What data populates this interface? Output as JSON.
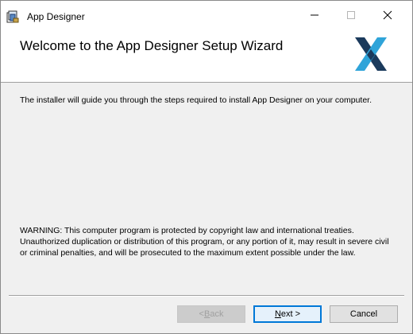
{
  "window": {
    "title": "App Designer"
  },
  "banner": {
    "heading": "Welcome to the App Designer Setup Wizard"
  },
  "content": {
    "intro": "The installer will guide you through the steps required to install App Designer on your computer.",
    "warning": "WARNING: This computer program is protected by copyright law and international treaties. Unauthorized duplication or distribution of this program, or any portion of it, may result in severe civil or criminal penalties, and will be prosecuted to the maximum extent possible under the law."
  },
  "buttons": {
    "back_prefix": "< ",
    "back_key": "B",
    "back_rest": "ack",
    "next_key": "N",
    "next_rest": "ext >",
    "cancel": "Cancel"
  },
  "icons": {
    "app": "installer-app-icon",
    "logo": "x-logo",
    "minimize": "minimize-icon",
    "maximize": "maximize-icon",
    "close": "close-icon"
  },
  "colors": {
    "logo_dark": "#1b3a5c",
    "logo_light": "#2fa4d9",
    "accent": "#0078d7"
  }
}
